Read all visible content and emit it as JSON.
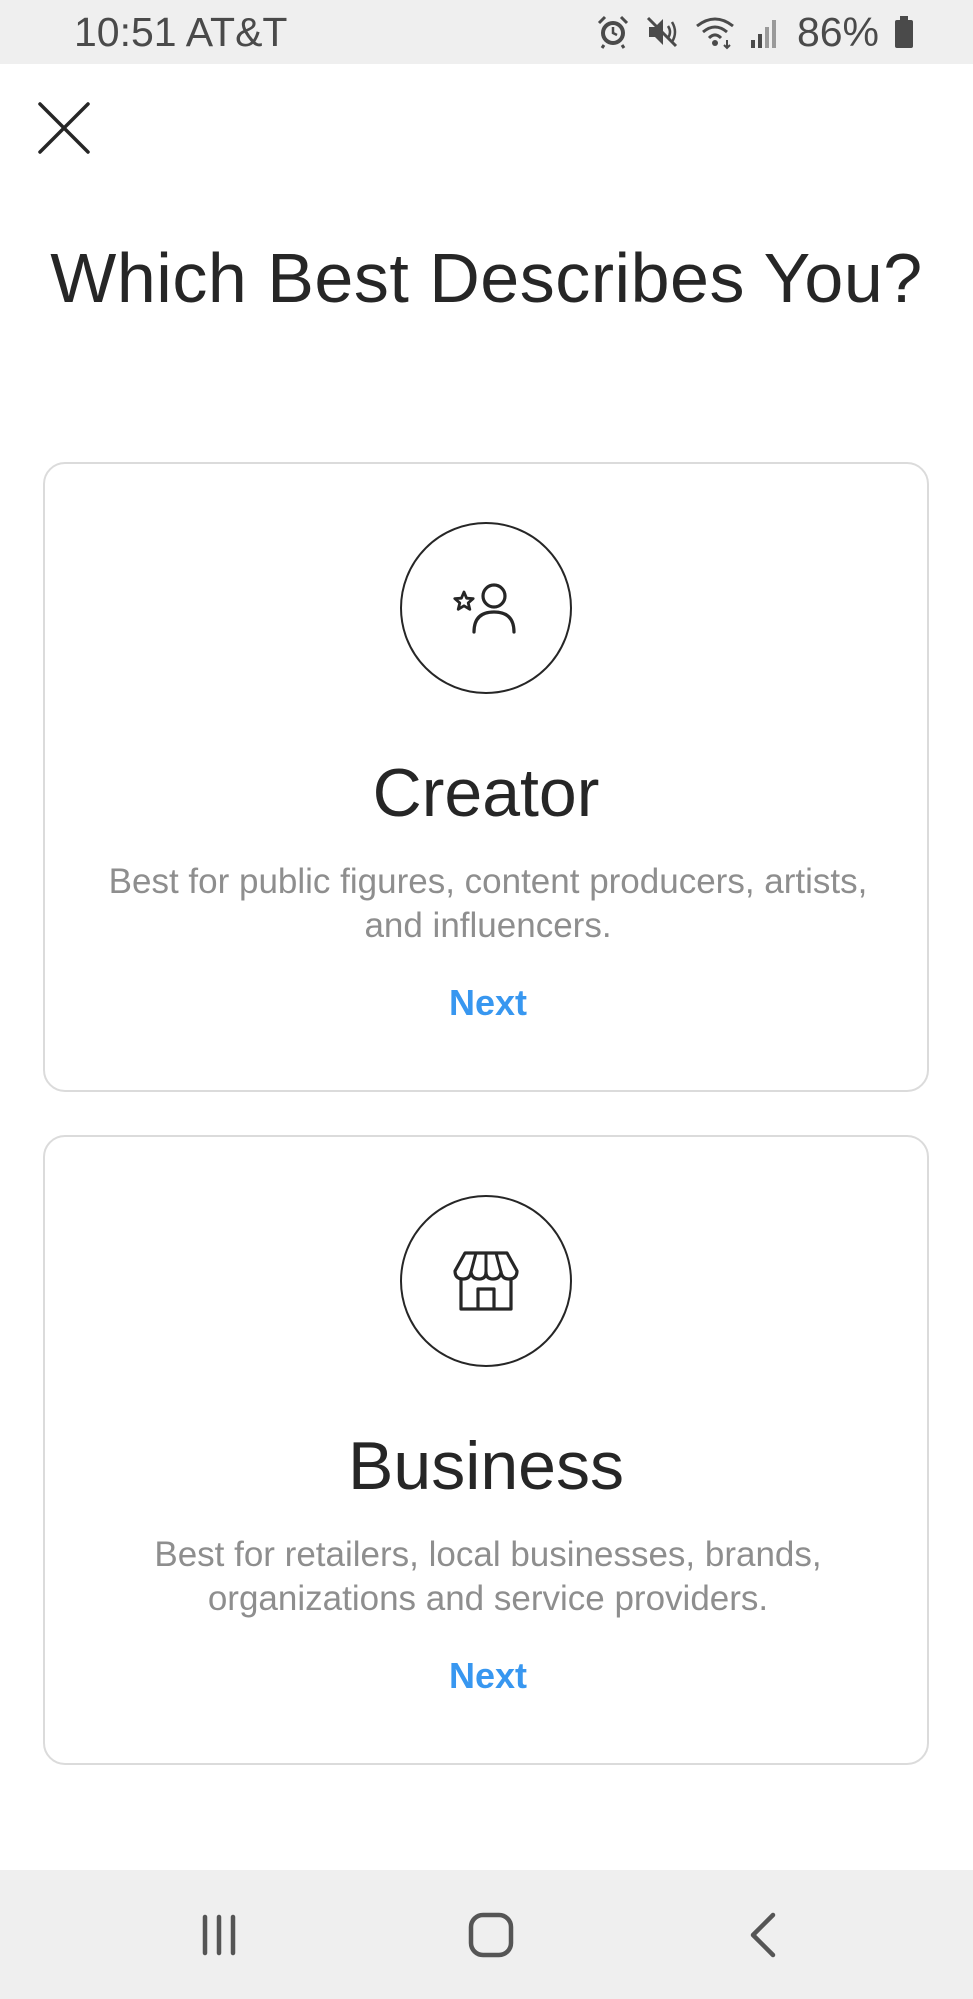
{
  "status_bar": {
    "time_carrier": "10:51 AT&T",
    "icons": [
      "alarm-icon",
      "mute-icon",
      "wifi-icon",
      "signal-icon",
      "battery-icon"
    ],
    "battery": "86%"
  },
  "header": {
    "close_icon": "close-icon",
    "title": "Which Best Describes You?"
  },
  "cards": [
    {
      "icon": "creator-star-person-icon",
      "title": "Creator",
      "description": "Best for public figures, content producers, artists, and influencers.",
      "action": "Next"
    },
    {
      "icon": "storefront-icon",
      "title": "Business",
      "description": "Best for retailers, local businesses, brands, organizations and service providers.",
      "action": "Next"
    }
  ],
  "nav_bar": {
    "icons": [
      "recent-apps-icon",
      "home-icon",
      "back-icon"
    ]
  },
  "colors": {
    "accent": "#3897f0",
    "text_primary": "#262626",
    "text_secondary": "#8e8e8e",
    "border": "#dbdbdb",
    "system_bar": "#efefef"
  }
}
